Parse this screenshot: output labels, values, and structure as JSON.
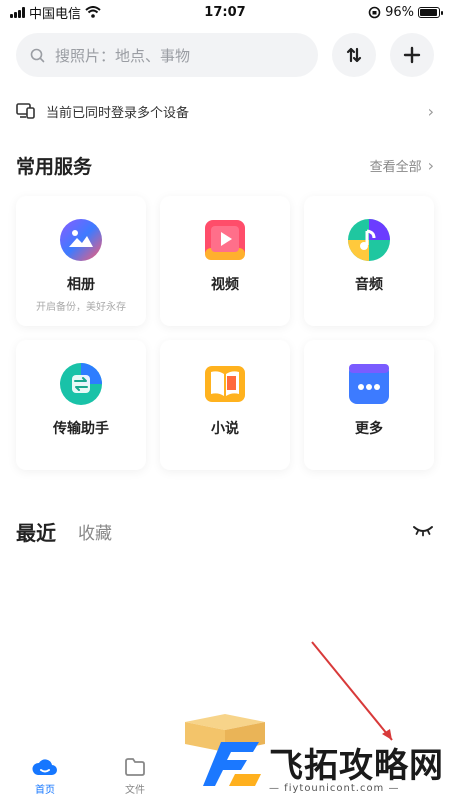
{
  "status_bar": {
    "carrier": "中国电信",
    "time": "17:07",
    "battery_text": "96%",
    "battery_level": 0.96
  },
  "search": {
    "placeholder": "搜照片：地点、事物"
  },
  "device_notice": {
    "text": "当前已同时登录多个设备"
  },
  "services": {
    "title": "常用服务",
    "view_all": "查看全部",
    "cards": [
      {
        "label": "相册",
        "sub": "开启备份，美好永存",
        "icon": "album-icon"
      },
      {
        "label": "视频",
        "icon": "video-icon"
      },
      {
        "label": "音频",
        "icon": "audio-icon"
      },
      {
        "label": "传输助手",
        "icon": "transfer-icon"
      },
      {
        "label": "小说",
        "icon": "novel-icon"
      },
      {
        "label": "更多",
        "icon": "more-icon"
      }
    ]
  },
  "recent": {
    "tab_recent": "最近",
    "tab_favorites": "收藏"
  },
  "bottom_nav": {
    "items": [
      {
        "label": "首页",
        "icon": "cloud-home-icon",
        "active": true
      },
      {
        "label": "文件",
        "icon": "folder-icon",
        "active": false
      }
    ]
  },
  "watermark": {
    "title": "飞拓攻略网",
    "url": "— fiytounicont.com —"
  },
  "colors": {
    "accent": "#1677ff",
    "background": "#ffffff",
    "input_bg": "#f2f3f5"
  }
}
